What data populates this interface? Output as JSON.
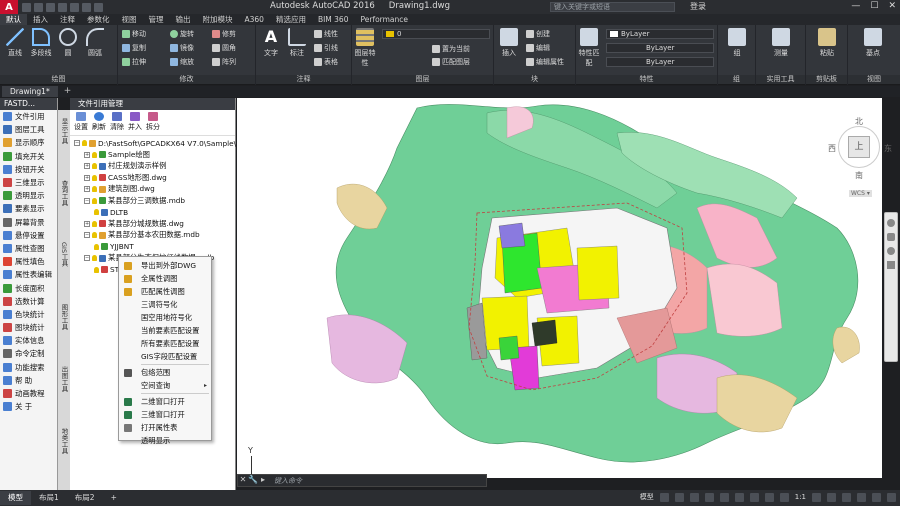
{
  "titlebar": {
    "app": "Autodesk AutoCAD 2016",
    "document": "Drawing1.dwg",
    "search_placeholder": "键入关键字或短语",
    "user": "登录",
    "window_controls": [
      "—",
      "☐",
      "✕"
    ]
  },
  "ribbon_tabs": [
    "默认",
    "插入",
    "注释",
    "参数化",
    "视图",
    "管理",
    "输出",
    "附加模块",
    "A360",
    "精选应用",
    "BIM 360",
    "Performance"
  ],
  "ribbon": {
    "draw": {
      "title": "绘图",
      "line": "直线",
      "polyline": "多段线",
      "circle": "圆",
      "arc": "圆弧"
    },
    "modify": {
      "title": "修改",
      "move": "移动",
      "rotate": "旋转",
      "trim": "修剪",
      "copy": "复制",
      "mirror": "镜像",
      "fillet": "圆角",
      "stretch": "拉伸",
      "scale": "缩放",
      "array": "阵列"
    },
    "annotation": {
      "title": "注释",
      "text": "文字",
      "dimension": "标注",
      "linear": "线性",
      "leader": "引线",
      "table": "表格"
    },
    "layers": {
      "title": "图层",
      "layer_props": "图层特性",
      "current_layer": "0",
      "make_current": "置为当前",
      "match_layer": "匹配图层"
    },
    "block": {
      "title": "块",
      "insert": "插入",
      "create": "创建",
      "edit": "编辑",
      "edit_attr": "编辑属性"
    },
    "properties": {
      "title": "特性",
      "match": "特性匹配",
      "color": "ByLayer",
      "linetype": "ByLayer",
      "lineweight": "ByLayer"
    },
    "groups": {
      "title": "组",
      "group": "组"
    },
    "utilities": {
      "title": "实用工具",
      "measure": "测量"
    },
    "clipboard": {
      "title": "剪贴板",
      "paste": "粘贴"
    },
    "view": {
      "title": "视图",
      "base": "基点"
    }
  },
  "doctabs": {
    "active": "Drawing1*",
    "plus": "+"
  },
  "fastd": {
    "header": "FASTD...",
    "items": [
      "文件引用",
      "图层工具",
      "显示顺序",
      "填充开关",
      "按钮开关",
      "三维显示",
      "透明显示",
      "要素显示",
      "屏幕背景",
      "悬停设置",
      "属性查图",
      "属性填色",
      "属性表编辑",
      "长度面积",
      "选数计算",
      "色块统计",
      "图块统计",
      "实体信息",
      "命令定制",
      "功能搜索",
      "帮    助",
      "动画教程",
      "关    于"
    ]
  },
  "vtabs": [
    "显示工具",
    "查询工具",
    "GIS工具",
    "图形工具",
    "出图工具",
    "地类工具"
  ],
  "fileref": {
    "header": "文件引用管理",
    "toolbar": [
      "设置",
      "刷新",
      "清除",
      "并入",
      "拆分"
    ],
    "tree": [
      {
        "label": "D:\\FastSoft\\GPCADKX64 V7.0\\Sample\\",
        "level": 0,
        "exp": "−"
      },
      {
        "label": "Sample绘图",
        "level": 1,
        "exp": "+"
      },
      {
        "label": "村庄规划演示样例",
        "level": 1,
        "exp": "+"
      },
      {
        "label": "CASS地形图.dwg",
        "level": 1,
        "exp": "+"
      },
      {
        "label": "建筑剖图.dwg",
        "level": 1,
        "exp": "+"
      },
      {
        "label": "某县部分三调数据.mdb",
        "level": 1,
        "exp": "−"
      },
      {
        "label": "DLTB",
        "level": 2,
        "exp": ""
      },
      {
        "label": "某县部分城规数据.dwg",
        "level": 1,
        "exp": "+"
      },
      {
        "label": "某县部分基本农田数据.mdb",
        "level": 1,
        "exp": "−"
      },
      {
        "label": "YJJBNT",
        "level": 2,
        "exp": ""
      },
      {
        "label": "某县部分生态保护红线数据.mdb",
        "level": 1,
        "exp": "−"
      },
      {
        "label": "STBHHX",
        "level": 2,
        "exp": ""
      }
    ]
  },
  "context_menu": [
    {
      "label": "导出到外部DWG",
      "arrow": ""
    },
    {
      "label": "全属性调图",
      "arrow": ""
    },
    {
      "label": "匹配属性调图",
      "arrow": ""
    },
    {
      "label": "三调符号化",
      "arrow": ""
    },
    {
      "label": "国空用地符号化",
      "arrow": ""
    },
    {
      "label": "当前要素匹配设置",
      "arrow": ""
    },
    {
      "label": "所有要素匹配设置",
      "arrow": ""
    },
    {
      "label": "GIS字段匹配设置",
      "arrow": ""
    },
    {
      "label": "包络范围",
      "arrow": ""
    },
    {
      "label": "空间查询",
      "arrow": "▸"
    },
    {
      "label": "二维窗口打开",
      "arrow": ""
    },
    {
      "label": "三维窗口打开",
      "arrow": ""
    },
    {
      "label": "打开属性表",
      "arrow": ""
    },
    {
      "label": "透明显示",
      "arrow": ""
    }
  ],
  "navcube": {
    "north": "北",
    "south": "南",
    "east": "东",
    "west": "西",
    "top": "上",
    "wcs": "WCS ▾"
  },
  "canvas": {
    "ucs_y": "Y"
  },
  "cmdline": {
    "placeholder": "键入命令",
    "buttons": [
      "✕",
      "🔧",
      "▸"
    ]
  },
  "statusbar": {
    "layout_tabs": [
      "模型",
      "布局1",
      "布局2"
    ],
    "plus": "+",
    "right": [
      "模型",
      "1:1"
    ]
  },
  "colors": {
    "ribbon_bg": "#33363b",
    "title_bg": "#2b2d31",
    "map_green": "#6fcf97",
    "map_yellow": "#f2f200",
    "map_pink": "#f8b3c8",
    "map_magenta": "#e23bd8"
  }
}
